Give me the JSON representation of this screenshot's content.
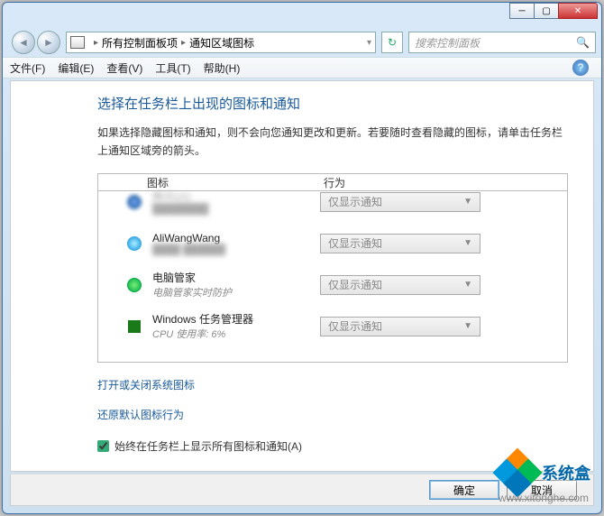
{
  "breadcrumb": {
    "part1": "所有控制面板项",
    "part2": "通知区域图标"
  },
  "search": {
    "placeholder": "搜索控制面板"
  },
  "menu": {
    "file": "文件(F)",
    "edit": "编辑(E)",
    "view": "查看(V)",
    "tools": "工具(T)",
    "help": "帮助(H)"
  },
  "page": {
    "title": "选择在任务栏上出现的图标和通知",
    "desc": "如果选择隐藏图标和通知，则不会向您通知更改和更新。若要随时查看隐藏的图标，请单击任务栏上通知区域旁的箭头。"
  },
  "columns": {
    "c1": "图标",
    "c2": "行为"
  },
  "select_label": "仅显示通知",
  "items": [
    {
      "name": "腾讯QQ",
      "sub": "",
      "blur": true
    },
    {
      "name": "AliWangWang",
      "sub": "",
      "blur_sub": true
    },
    {
      "name": "电脑管家",
      "sub": "电脑管家实时防护"
    },
    {
      "name": "Windows 任务管理器",
      "sub": "CPU 使用率: 6%"
    }
  ],
  "links": {
    "sys_icons": "打开或关闭系统图标",
    "restore": "还原默认图标行为"
  },
  "checkbox": {
    "label": "始终在任务栏上显示所有图标和通知(A)",
    "checked": true
  },
  "buttons": {
    "ok": "确定",
    "cancel": "取消"
  },
  "watermark": {
    "brand": "系统盒",
    "url": "www.xitonghe.com"
  }
}
